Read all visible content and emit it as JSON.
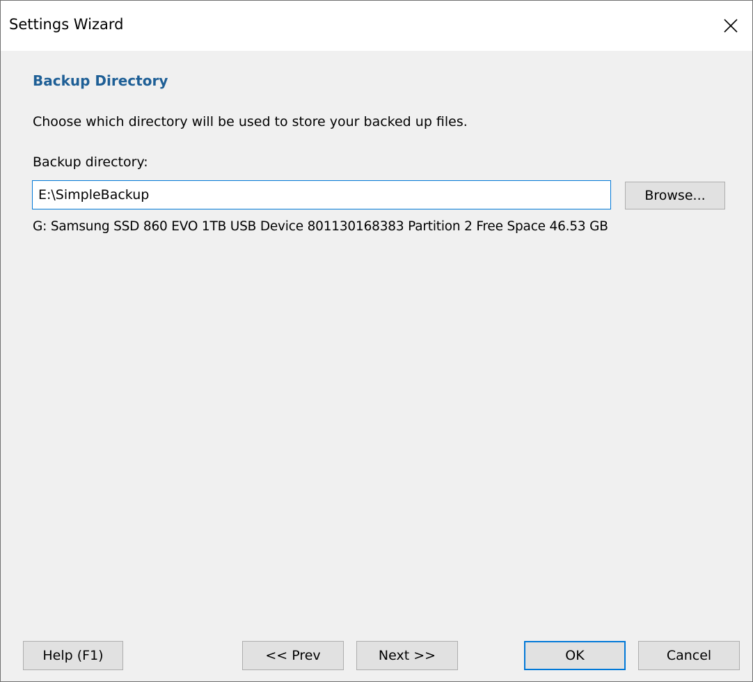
{
  "window": {
    "title": "Settings Wizard"
  },
  "page": {
    "heading": "Backup Directory",
    "instruction": "Choose which directory will be used to store your backed up files.",
    "field_label": "Backup directory:",
    "directory_value": "E:\\SimpleBackup",
    "browse_label": "Browse...",
    "drive_info": "G: Samsung SSD 860 EVO 1TB USB Device 801130168383 Partition 2 Free Space 46.53 GB"
  },
  "footer": {
    "help_label": "Help (F1)",
    "prev_label": "<< Prev",
    "next_label": "Next >>",
    "ok_label": "OK",
    "cancel_label": "Cancel"
  },
  "colors": {
    "heading": "#1e5f96",
    "focus_border": "#0078d7",
    "button_face": "#e1e1e1",
    "dialog_background": "#f0f0f0"
  },
  "icons": {
    "close": "close-icon"
  }
}
